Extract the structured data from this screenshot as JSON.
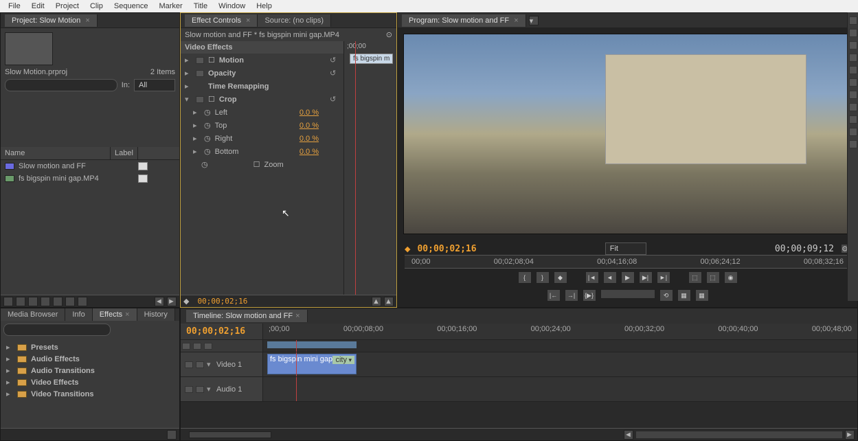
{
  "menu": [
    "File",
    "Edit",
    "Project",
    "Clip",
    "Sequence",
    "Marker",
    "Title",
    "Window",
    "Help"
  ],
  "project": {
    "tab_label": "Project: Slow Motion",
    "filename": "Slow Motion.prproj",
    "item_count": "2 Items",
    "in_label": "In:",
    "in_value": "All",
    "col_name": "Name",
    "col_label": "Label",
    "items": [
      {
        "name": "Slow motion and FF"
      },
      {
        "name": "fs bigspin mini gap.MP4"
      }
    ]
  },
  "effect_controls": {
    "tab_active": "Effect Controls",
    "tab_inactive": "Source: (no clips)",
    "breadcrumb": "Slow motion and FF * fs bigspin mini gap.MP4",
    "timecode_head": ";00;00",
    "clip_tag": "fs bigspin m",
    "section": "Video Effects",
    "rows": {
      "motion": "Motion",
      "opacity": "Opacity",
      "time_remap": "Time Remapping",
      "crop": "Crop",
      "left": "Left",
      "left_v": "0.0 %",
      "top": "Top",
      "top_v": "0.0 %",
      "right": "Right",
      "right_v": "0.0 %",
      "bottom": "Bottom",
      "bottom_v": "0.0 %",
      "zoom": "Zoom"
    },
    "footer_tc": "00;00;02;16"
  },
  "program": {
    "tab": "Program: Slow motion and FF",
    "tc_left": "00;00;02;16",
    "fit": "Fit",
    "tc_right": "00;00;09;12",
    "ruler": [
      "00;00",
      "00;02;08;04",
      "00;04;16;08",
      "00;06;24;12",
      "00;08;32;16"
    ]
  },
  "lower_tabs": {
    "media_browser": "Media Browser",
    "info": "Info",
    "effects": "Effects",
    "history": "History",
    "folders": [
      "Presets",
      "Audio Effects",
      "Audio Transitions",
      "Video Effects",
      "Video Transitions"
    ]
  },
  "timeline": {
    "tab": "Timeline: Slow motion and FF",
    "tc": "00;00;02;16",
    "ruler": [
      ";00;00",
      "00;00;08;00",
      "00;00;16;00",
      "00;00;24;00",
      "00;00;32;00",
      "00;00;40;00",
      "00;00;48;00"
    ],
    "video_track": "Video 1",
    "audio_track": "Audio 1",
    "clip_name": "fs bigspin mini gap.MP4",
    "clip_chip": "city"
  }
}
